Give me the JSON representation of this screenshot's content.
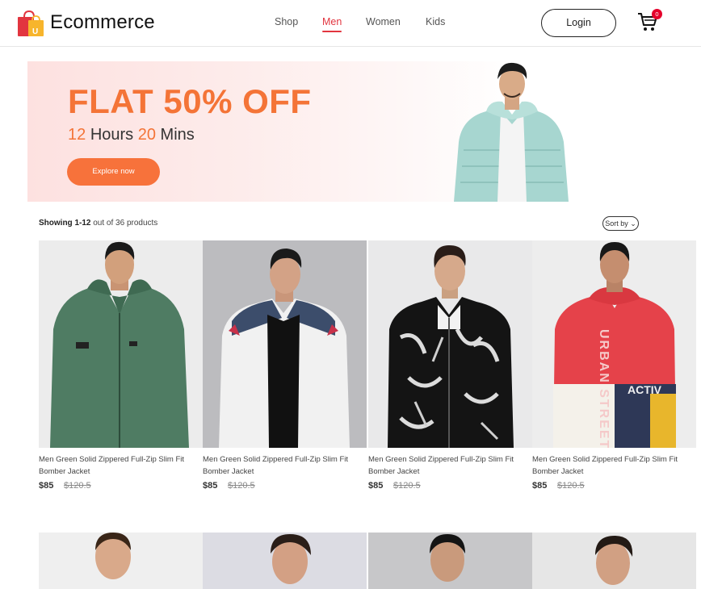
{
  "header": {
    "brand": "Ecommerce",
    "nav": [
      {
        "label": "Shop",
        "active": false
      },
      {
        "label": "Men",
        "active": true
      },
      {
        "label": "Women",
        "active": false
      },
      {
        "label": "Kids",
        "active": false
      }
    ],
    "login_label": "Login",
    "cart_count": "0",
    "accent_color": "#e2353f"
  },
  "banner": {
    "title": "FLAT 50% OFF",
    "timer_hours": "12",
    "timer_hours_label": "Hours",
    "timer_mins": "20",
    "timer_mins_label": "Mins",
    "cta_label": "Explore now",
    "accent_color": "#f47437"
  },
  "results": {
    "prefix": "Showing",
    "range": "1-12",
    "suffix": "out of 36 products",
    "sort_label": "Sort by"
  },
  "products": [
    {
      "name": "Men Green Solid Zippered Full-Zip Slim Fit Bomber Jacket",
      "price": "$85",
      "old_price": "$120.5"
    },
    {
      "name": "Men Green Solid Zippered Full-Zip Slim Fit Bomber Jacket",
      "price": "$85",
      "old_price": "$120.5"
    },
    {
      "name": "Men Green Solid Zippered Full-Zip Slim Fit Bomber Jacket",
      "price": "$85",
      "old_price": "$120.5"
    },
    {
      "name": "Men Green Solid Zippered Full-Zip Slim Fit Bomber Jacket",
      "price": "$85",
      "old_price": "$120.5"
    }
  ],
  "icons": {
    "logo": "shopping-bag-icon",
    "cart": "cart-icon",
    "sort": "chevron-down-icon"
  }
}
